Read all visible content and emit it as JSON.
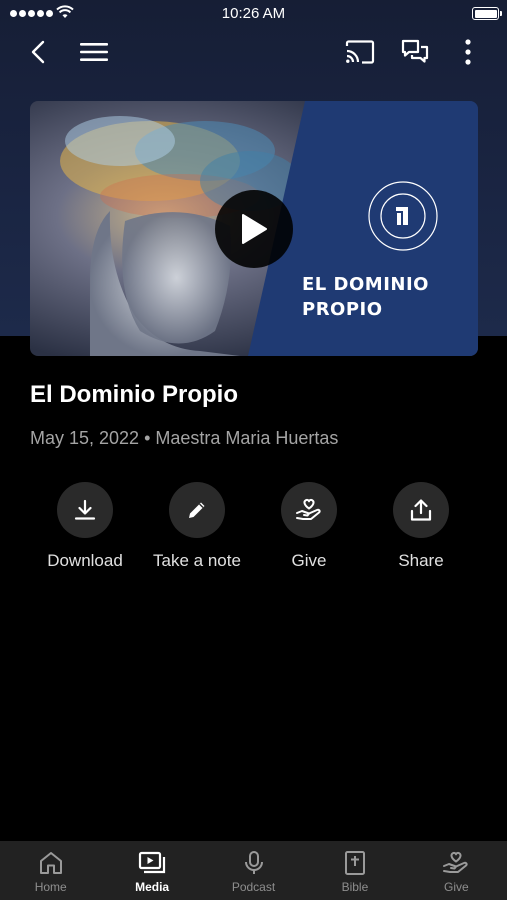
{
  "status_bar": {
    "time": "10:26 AM"
  },
  "nav": {
    "back_icon": "chevron-left-icon",
    "menu_icon": "hamburger-icon",
    "cast_icon": "cast-icon",
    "chat_icon": "chat-bubbles-icon",
    "more_icon": "more-vertical-icon"
  },
  "media": {
    "thumbnail_title_line1": "EL DOMINIO",
    "thumbnail_title_line2": "PROPIO",
    "title": "El Dominio Propio",
    "meta": "May 15, 2022 • Maestra Maria Huertas"
  },
  "actions": [
    {
      "label": "Download",
      "icon": "download-icon"
    },
    {
      "label": "Take a note",
      "icon": "pencil-icon"
    },
    {
      "label": "Give",
      "icon": "giving-hand-icon"
    },
    {
      "label": "Share",
      "icon": "share-icon"
    }
  ],
  "tabs": [
    {
      "label": "Home",
      "icon": "home-icon",
      "active": false
    },
    {
      "label": "Media",
      "icon": "media-icon",
      "active": true
    },
    {
      "label": "Podcast",
      "icon": "microphone-icon",
      "active": false
    },
    {
      "label": "Bible",
      "icon": "bible-icon",
      "active": false
    },
    {
      "label": "Give",
      "icon": "giving-hand-icon",
      "active": false
    }
  ],
  "colors": {
    "header_bg": "#1a2543",
    "thumbnail_panel": "#1f3a73",
    "muted_text": "#a4a4a4",
    "tab_bar_bg": "#222222"
  }
}
